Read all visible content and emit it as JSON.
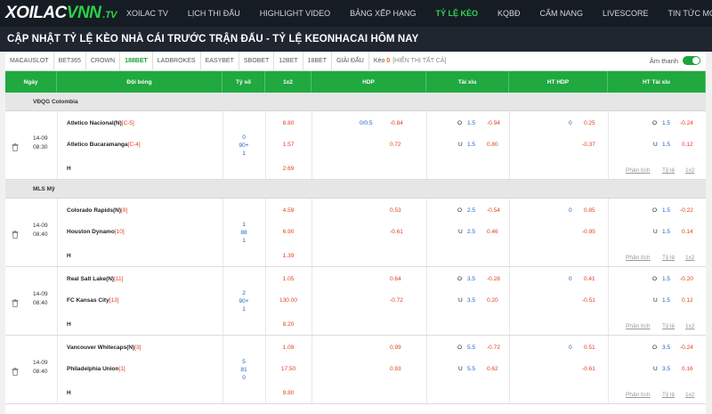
{
  "nav": {
    "logo": {
      "part1": "XOILAC",
      "part2": "VNN",
      "part3": ".TV"
    },
    "items": [
      "XOILAC TV",
      "LỊCH THI ĐẤU",
      "HIGHLIGHT VIDEO",
      "BẢNG XẾP HẠNG",
      "TỶ LỆ KÈO",
      "KQBĐ",
      "CẨM NANG",
      "LIVESCORE",
      "TIN TỨC MỚI"
    ],
    "active_index": 4
  },
  "page_title": "CẬP NHẬT TỶ LỆ KÈO NHÀ CÁI TRƯỚC TRẬN ĐẤU - TỶ LỆ KEONHACAI HÔM NAY",
  "bookmaker_tabs": [
    "MACAUSLOT",
    "BET365",
    "CROWN",
    "188BET",
    "LADBROKES",
    "EASYBET",
    "SBOBET",
    "12BET",
    "18BET",
    "GIẢI ĐẤU"
  ],
  "active_tab_index": 3,
  "keo_label": "Kèo",
  "keo_count": "0",
  "show_all": "[HIỂN THỊ TẤT CẢ]",
  "sound_label": "Âm thanh",
  "sound_on": true,
  "columns": [
    "Ngày",
    "Đội bóng",
    "Tỷ số",
    "1x2",
    "HDP",
    "Tài xỉu",
    "HT HDP",
    "HT Tài xỉu"
  ],
  "links": {
    "analysis": "Phân tích",
    "odds": "Tỷ lệ",
    "onex2": "1x2"
  },
  "colors": {
    "accent": "#1fa93f",
    "nav_bg": "#161c24",
    "negative": "#e04020",
    "line": "#1c62c8"
  },
  "leagues": [
    {
      "name": "VĐQG Colombia",
      "match": {
        "date": "14-09",
        "time": "08:30",
        "home": "Atletico Nacional(N)",
        "home_rank": "[C-5]",
        "away": "Atletico Bucaramanga",
        "away_rank": "[C-4]",
        "h_label": "H",
        "score": [
          "0",
          "90+",
          "1"
        ],
        "odds_1x2": [
          "8.80",
          "1.57",
          "2.69"
        ],
        "hdp": {
          "line": "0/0.5",
          "home": "-0.84",
          "away": "0.72"
        },
        "ou": {
          "o_label": "O",
          "o_line": "1.5",
          "o_odds": "-0.94",
          "u_label": "U",
          "u_line": "1.5",
          "u_odds": "0.80"
        },
        "ht_hdp": {
          "line": "0",
          "home": "0.25",
          "away": "-0.37"
        },
        "ht_ou": {
          "o_label": "O",
          "o_line": "1.5",
          "o_odds": "-0.24",
          "u_label": "U",
          "u_line": "1.5",
          "u_odds": "0.12"
        }
      }
    },
    {
      "name": "MLS Mỹ",
      "match": {
        "date": "14-09",
        "time": "08:40",
        "home": "Colorado Rapids(N)",
        "home_rank": "[8]",
        "away": "Houston Dynamo",
        "away_rank": "[10]",
        "h_label": "H",
        "score": [
          "1",
          "88",
          "1"
        ],
        "odds_1x2": [
          "4.59",
          "6.90",
          "1.39"
        ],
        "hdp": {
          "line": "",
          "home": "0.53",
          "away": "-0.61"
        },
        "ou": {
          "o_label": "O",
          "o_line": "2.5",
          "o_odds": "-0.54",
          "u_label": "U",
          "u_line": "2.5",
          "u_odds": "0.46"
        },
        "ht_hdp": {
          "line": "0",
          "home": "0.85",
          "away": "-0.95"
        },
        "ht_ou": {
          "o_label": "O",
          "o_line": "1.5",
          "o_odds": "-0.22",
          "u_label": "U",
          "u_line": "1.5",
          "u_odds": "0.14"
        }
      }
    },
    {
      "name": "",
      "match": {
        "date": "14-09",
        "time": "08:40",
        "home": "Real Salt Lake(N)",
        "home_rank": "[11]",
        "away": "FC Kansas City",
        "away_rank": "[13]",
        "h_label": "H",
        "score": [
          "2",
          "90+",
          "1"
        ],
        "odds_1x2": [
          "1.05",
          "130.00",
          "8.20"
        ],
        "hdp": {
          "line": "",
          "home": "0.64",
          "away": "-0.72"
        },
        "ou": {
          "o_label": "O",
          "o_line": "3.5",
          "o_odds": "-0.28",
          "u_label": "U",
          "u_line": "3.5",
          "u_odds": "0.20"
        },
        "ht_hdp": {
          "line": "0",
          "home": "0.41",
          "away": "-0.51"
        },
        "ht_ou": {
          "o_label": "O",
          "o_line": "1.5",
          "o_odds": "-0.20",
          "u_label": "U",
          "u_line": "1.5",
          "u_odds": "0.12"
        }
      }
    },
    {
      "name": "",
      "match": {
        "date": "14-09",
        "time": "08:40",
        "home": "Vancouver Whitecaps(N)",
        "home_rank": "[3]",
        "away": "Philadelphia Union",
        "away_rank": "[1]",
        "h_label": "H",
        "score": [
          "5",
          "81",
          "0"
        ],
        "odds_1x2": [
          "1.09",
          "17.50",
          "9.80"
        ],
        "hdp": {
          "line": "",
          "home": "0.99",
          "away": "0.93"
        },
        "ou": {
          "o_label": "O",
          "o_line": "5.5",
          "o_odds": "-0.72",
          "u_label": "U",
          "u_line": "5.5",
          "u_odds": "0.62"
        },
        "ht_hdp": {
          "line": "0",
          "home": "0.51",
          "away": "-0.61"
        },
        "ht_ou": {
          "o_label": "O",
          "o_line": "3.5",
          "o_odds": "-0.24",
          "u_label": "U",
          "u_line": "3.5",
          "u_odds": "0.16"
        }
      }
    }
  ]
}
